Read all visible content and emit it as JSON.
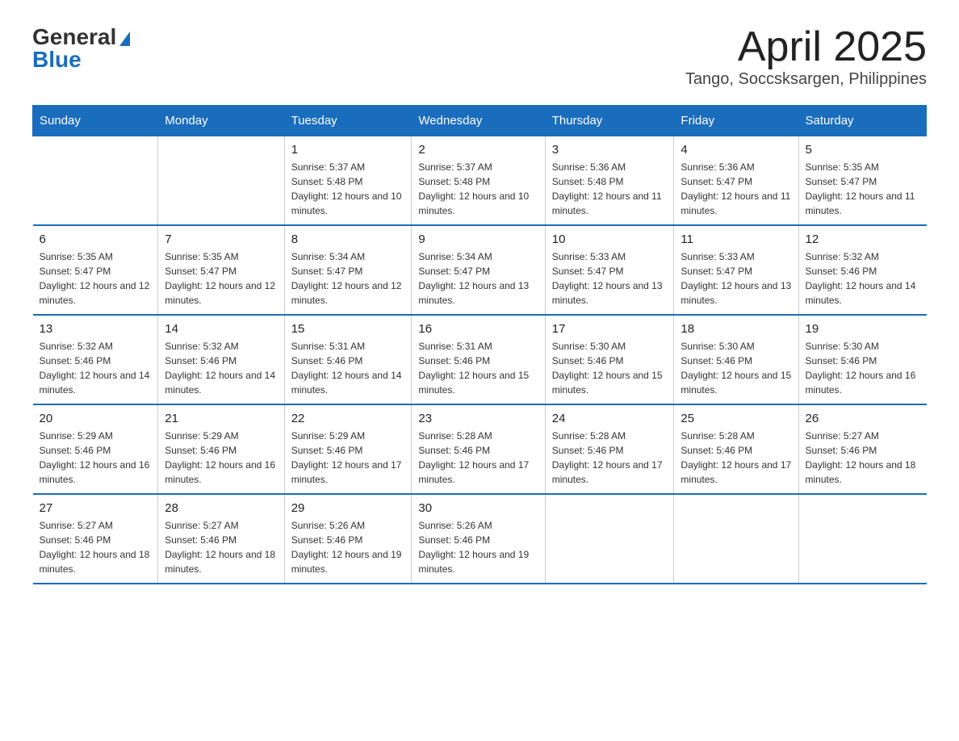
{
  "header": {
    "logo_general": "General",
    "logo_blue": "Blue",
    "month_title": "April 2025",
    "subtitle": "Tango, Soccsksargen, Philippines"
  },
  "days_of_week": [
    "Sunday",
    "Monday",
    "Tuesday",
    "Wednesday",
    "Thursday",
    "Friday",
    "Saturday"
  ],
  "weeks": [
    [
      {
        "day": "",
        "sunrise": "",
        "sunset": "",
        "daylight": ""
      },
      {
        "day": "",
        "sunrise": "",
        "sunset": "",
        "daylight": ""
      },
      {
        "day": "1",
        "sunrise": "5:37 AM",
        "sunset": "5:48 PM",
        "daylight": "12 hours and 10 minutes."
      },
      {
        "day": "2",
        "sunrise": "5:37 AM",
        "sunset": "5:48 PM",
        "daylight": "12 hours and 10 minutes."
      },
      {
        "day": "3",
        "sunrise": "5:36 AM",
        "sunset": "5:48 PM",
        "daylight": "12 hours and 11 minutes."
      },
      {
        "day": "4",
        "sunrise": "5:36 AM",
        "sunset": "5:47 PM",
        "daylight": "12 hours and 11 minutes."
      },
      {
        "day": "5",
        "sunrise": "5:35 AM",
        "sunset": "5:47 PM",
        "daylight": "12 hours and 11 minutes."
      }
    ],
    [
      {
        "day": "6",
        "sunrise": "5:35 AM",
        "sunset": "5:47 PM",
        "daylight": "12 hours and 12 minutes."
      },
      {
        "day": "7",
        "sunrise": "5:35 AM",
        "sunset": "5:47 PM",
        "daylight": "12 hours and 12 minutes."
      },
      {
        "day": "8",
        "sunrise": "5:34 AM",
        "sunset": "5:47 PM",
        "daylight": "12 hours and 12 minutes."
      },
      {
        "day": "9",
        "sunrise": "5:34 AM",
        "sunset": "5:47 PM",
        "daylight": "12 hours and 13 minutes."
      },
      {
        "day": "10",
        "sunrise": "5:33 AM",
        "sunset": "5:47 PM",
        "daylight": "12 hours and 13 minutes."
      },
      {
        "day": "11",
        "sunrise": "5:33 AM",
        "sunset": "5:47 PM",
        "daylight": "12 hours and 13 minutes."
      },
      {
        "day": "12",
        "sunrise": "5:32 AM",
        "sunset": "5:46 PM",
        "daylight": "12 hours and 14 minutes."
      }
    ],
    [
      {
        "day": "13",
        "sunrise": "5:32 AM",
        "sunset": "5:46 PM",
        "daylight": "12 hours and 14 minutes."
      },
      {
        "day": "14",
        "sunrise": "5:32 AM",
        "sunset": "5:46 PM",
        "daylight": "12 hours and 14 minutes."
      },
      {
        "day": "15",
        "sunrise": "5:31 AM",
        "sunset": "5:46 PM",
        "daylight": "12 hours and 14 minutes."
      },
      {
        "day": "16",
        "sunrise": "5:31 AM",
        "sunset": "5:46 PM",
        "daylight": "12 hours and 15 minutes."
      },
      {
        "day": "17",
        "sunrise": "5:30 AM",
        "sunset": "5:46 PM",
        "daylight": "12 hours and 15 minutes."
      },
      {
        "day": "18",
        "sunrise": "5:30 AM",
        "sunset": "5:46 PM",
        "daylight": "12 hours and 15 minutes."
      },
      {
        "day": "19",
        "sunrise": "5:30 AM",
        "sunset": "5:46 PM",
        "daylight": "12 hours and 16 minutes."
      }
    ],
    [
      {
        "day": "20",
        "sunrise": "5:29 AM",
        "sunset": "5:46 PM",
        "daylight": "12 hours and 16 minutes."
      },
      {
        "day": "21",
        "sunrise": "5:29 AM",
        "sunset": "5:46 PM",
        "daylight": "12 hours and 16 minutes."
      },
      {
        "day": "22",
        "sunrise": "5:29 AM",
        "sunset": "5:46 PM",
        "daylight": "12 hours and 17 minutes."
      },
      {
        "day": "23",
        "sunrise": "5:28 AM",
        "sunset": "5:46 PM",
        "daylight": "12 hours and 17 minutes."
      },
      {
        "day": "24",
        "sunrise": "5:28 AM",
        "sunset": "5:46 PM",
        "daylight": "12 hours and 17 minutes."
      },
      {
        "day": "25",
        "sunrise": "5:28 AM",
        "sunset": "5:46 PM",
        "daylight": "12 hours and 17 minutes."
      },
      {
        "day": "26",
        "sunrise": "5:27 AM",
        "sunset": "5:46 PM",
        "daylight": "12 hours and 18 minutes."
      }
    ],
    [
      {
        "day": "27",
        "sunrise": "5:27 AM",
        "sunset": "5:46 PM",
        "daylight": "12 hours and 18 minutes."
      },
      {
        "day": "28",
        "sunrise": "5:27 AM",
        "sunset": "5:46 PM",
        "daylight": "12 hours and 18 minutes."
      },
      {
        "day": "29",
        "sunrise": "5:26 AM",
        "sunset": "5:46 PM",
        "daylight": "12 hours and 19 minutes."
      },
      {
        "day": "30",
        "sunrise": "5:26 AM",
        "sunset": "5:46 PM",
        "daylight": "12 hours and 19 minutes."
      },
      {
        "day": "",
        "sunrise": "",
        "sunset": "",
        "daylight": ""
      },
      {
        "day": "",
        "sunrise": "",
        "sunset": "",
        "daylight": ""
      },
      {
        "day": "",
        "sunrise": "",
        "sunset": "",
        "daylight": ""
      }
    ]
  ]
}
